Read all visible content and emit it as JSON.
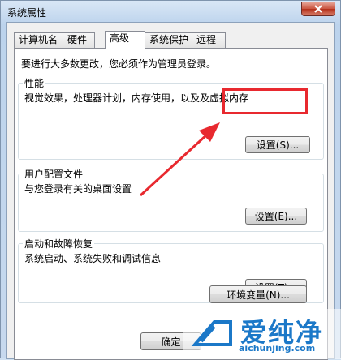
{
  "window": {
    "title": "系统属性",
    "close_icon": "close-icon"
  },
  "tabs": [
    {
      "label": "计算机名",
      "active": false
    },
    {
      "label": "硬件",
      "active": false
    },
    {
      "label": "高级",
      "active": true
    },
    {
      "label": "系统保护",
      "active": false
    },
    {
      "label": "远程",
      "active": false
    }
  ],
  "panel": {
    "intro": "要进行大多数更改，您必须作为管理员登录。",
    "performance": {
      "title": "性能",
      "description": "视觉效果，处理器计划，内存使用，以及及虚拟内存",
      "button": "设置(S)..."
    },
    "user_profiles": {
      "title": "用户配置文件",
      "description": "与您登录有关的桌面设置",
      "button": "设置(E)..."
    },
    "startup_recovery": {
      "title": "启动和故障恢复",
      "description": "系统启动、系统失败和调试信息",
      "button": "设置(T)..."
    },
    "env_button": "环境变量(N)..."
  },
  "footer": {
    "ok_button": "确定"
  },
  "watermark": {
    "brand": "爱纯净",
    "url": "aichunjing.com"
  },
  "colors": {
    "highlight": "#e8292f",
    "brand": "#1b78c8"
  }
}
